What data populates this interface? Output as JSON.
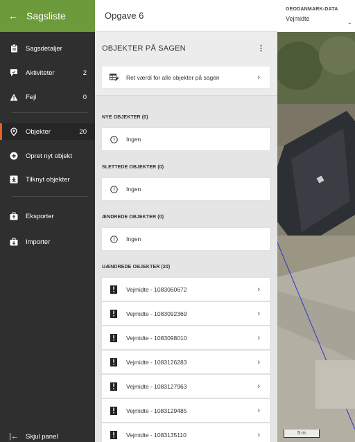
{
  "sidebar": {
    "header_title": "Sagsliste",
    "items": [
      {
        "label": "Sagsdetaljer",
        "count": ""
      },
      {
        "label": "Aktiviteter",
        "count": "2"
      },
      {
        "label": "Fejl",
        "count": "0"
      },
      {
        "label": "Objekter",
        "count": "20"
      },
      {
        "label": "Opret nyt objekt",
        "count": ""
      },
      {
        "label": "Tilknyt objekter",
        "count": ""
      },
      {
        "label": "Eksporter",
        "count": ""
      },
      {
        "label": "Importer",
        "count": ""
      }
    ],
    "hide_label": "Skjul panel",
    "active_accent": "#e0641b",
    "header_color": "#6d9a3b"
  },
  "panel": {
    "title": "Opgave 6",
    "objects_title": "OBJEKTER PÅ SAGEN",
    "bulk_action": "Ret værdi for alle objekter på sagen",
    "sections": {
      "new": "NYE OBJEKTER (0)",
      "deleted": "SLETTEDE OBJEKTER (0)",
      "changed": "ÆNDREDE OBJEKTER (0)",
      "unchanged": "UÆNDREDE OBJEKTER (20)"
    },
    "none_label": "Ingen",
    "objects": [
      "Vejmidte - 1083060672",
      "Vejmidte - 1083092369",
      "Vejmidte - 1083098010",
      "Vejmidte - 1083126283",
      "Vejmidte - 1083127963",
      "Vejmidte - 1083129485",
      "Vejmidte - 1083135110"
    ]
  },
  "map": {
    "layer_title": "GEODANMARK-DATA",
    "layer_value": "Vejmidte",
    "scale_label": "5 m"
  }
}
